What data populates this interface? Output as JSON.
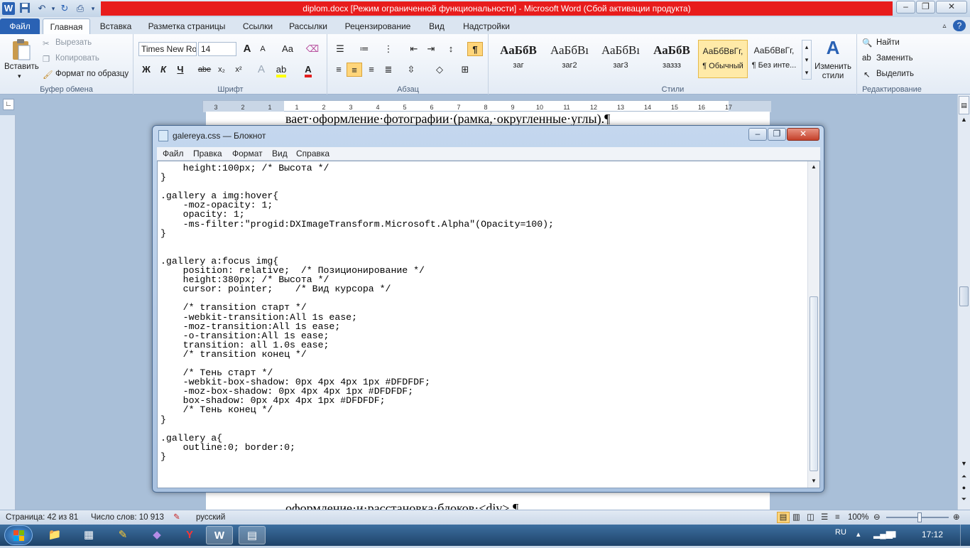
{
  "window": {
    "title": "diplom.docx [Режим ограниченной функциональности]  -  Microsoft Word (Сбой активации продукта)",
    "app_icon_glyph": "W",
    "accent_red": "#e81c1c"
  },
  "quick_access": {
    "icons": [
      "word-logo-icon",
      "save-icon",
      "undo-icon",
      "redo-icon",
      "print-preview-icon",
      "customize-icon"
    ]
  },
  "tabs": [
    {
      "label": "Файл"
    },
    {
      "label": "Главная"
    },
    {
      "label": "Вставка"
    },
    {
      "label": "Разметка страницы"
    },
    {
      "label": "Ссылки"
    },
    {
      "label": "Рассылки"
    },
    {
      "label": "Рецензирование"
    },
    {
      "label": "Вид"
    },
    {
      "label": "Надстройки"
    }
  ],
  "ribbon": {
    "clipboard": {
      "paste": "Вставить",
      "cut": "Вырезать",
      "copy": "Копировать",
      "format_painter": "Формат по образцу",
      "label": "Буфер обмена"
    },
    "font": {
      "family": "Times New Ro",
      "size": "14",
      "label": "Шрифт",
      "bold": "Ж",
      "italic": "К",
      "underline": "Ч",
      "strike": "abe",
      "sub": "x₂",
      "sup": "x²",
      "grow": "A",
      "shrink": "A",
      "case": "Aa"
    },
    "paragraph": {
      "label": "Абзац",
      "pilcrow": "¶"
    },
    "styles": {
      "label": "Стили",
      "items": [
        {
          "preview": "АаБбВ",
          "name": "заг"
        },
        {
          "preview": "АаБбВı",
          "name": "заг2"
        },
        {
          "preview": "АаБбВı",
          "name": "заг3"
        },
        {
          "preview": "АаБбВ",
          "name": "заззз"
        },
        {
          "preview": "АаБбВвГг,",
          "name": "¶ Обычный"
        },
        {
          "preview": "АаБбВвГг,",
          "name": "¶ Без инте..."
        }
      ],
      "change_styles": "Изменить стили"
    },
    "editing": {
      "label": "Редактирование",
      "find": "Найти",
      "replace": "Заменить",
      "select": "Выделить"
    }
  },
  "document": {
    "text_top": "вает·оформление·фотографии·(рамка,·округленные·углы).¶",
    "text_bottom": "оформление·и·расстановка·блоков·<div>.¶",
    "ruler_labels": [
      "3",
      "2",
      "1",
      "1",
      "2",
      "3",
      "4",
      "5",
      "6",
      "7",
      "8",
      "9",
      "10",
      "11",
      "12",
      "13",
      "14",
      "15",
      "16",
      "17"
    ]
  },
  "notepad": {
    "title": "galereya.css — Блокнот",
    "menu": [
      "Файл",
      "Правка",
      "Формат",
      "Вид",
      "Справка"
    ],
    "code": "    height:100px; /* Высота */\n}\n\n.gallery a img:hover{\n    -moz-opacity: 1;\n    opacity: 1;\n    -ms-filter:\"progid:DXImageTransform.Microsoft.Alpha\"(Opacity=100);\n}\n\n\n.gallery a:focus img{\n    position: relative;  /* Позиционирование */\n    height:380px; /* Высота */\n    cursor: pointer;    /* Вид курсора */\n\n    /* transition старт */\n    -webkit-transition:All 1s ease;\n    -moz-transition:All 1s ease;\n    -o-transition:All 1s ease;\n    transition: all 1.0s ease;\n    /* transition конец */\n\n    /* Тень старт */\n    -webkit-box-shadow: 0px 4px 4px 1px #DFDFDF;\n    -moz-box-shadow: 0px 4px 4px 1px #DFDFDF;\n    box-shadow: 0px 4px 4px 1px #DFDFDF;\n    /* Тень конец */\n}\n\n.gallery a{\n    outline:0; border:0;\n}"
  },
  "status": {
    "page": "Страница: 42 из 81",
    "words": "Число слов: 10 913",
    "language": "русский",
    "zoom": "100%"
  },
  "taskbar": {
    "lang": "RU",
    "time": "17:12"
  }
}
